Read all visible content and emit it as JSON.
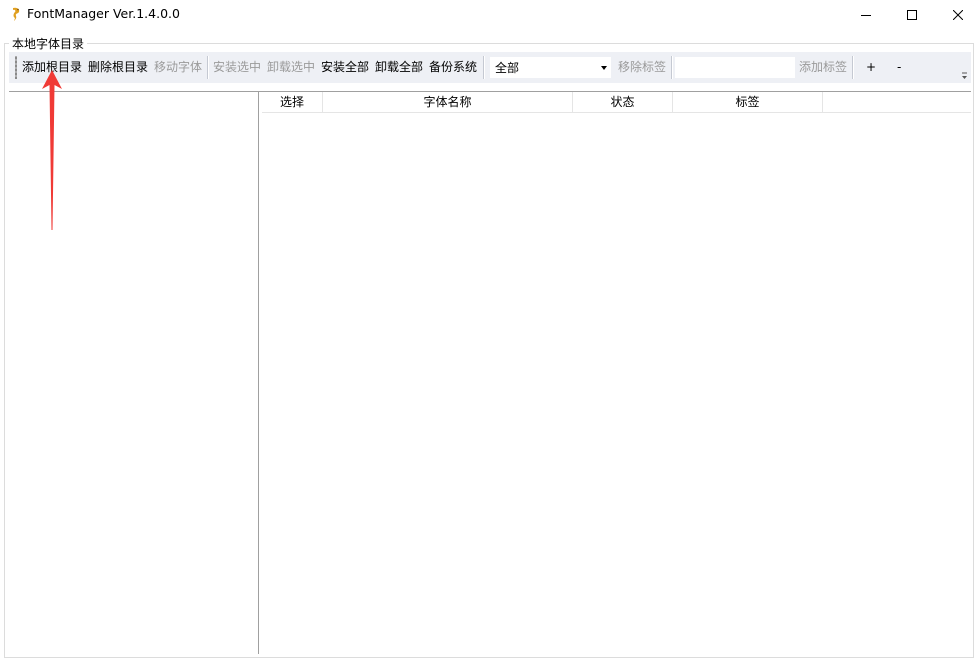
{
  "window": {
    "title": "FontManager Ver.1.4.0.0",
    "icon": "dragon-app-icon",
    "controls": [
      "minimize-icon",
      "maximize-icon",
      "close-icon"
    ]
  },
  "group": {
    "title": "本地字体目录"
  },
  "toolbar": {
    "add_root": "添加根目录",
    "delete_root": "删除根目录",
    "move_font": "移动字体",
    "install_selected": "安装选中",
    "uninstall_selected": "卸载选中",
    "install_all": "安装全部",
    "uninstall_all": "卸载全部",
    "backup_system": "备份系统",
    "filter_selected": "全部",
    "remove_tag": "移除标签",
    "tag_input_value": "",
    "add_tag": "添加标签",
    "plus": "+",
    "minus": "-"
  },
  "list": {
    "columns": [
      "选择",
      "字体名称",
      "状态",
      "标签"
    ],
    "rows": []
  },
  "colors": {
    "toolbar_bg": "#eef0f5",
    "disabled_text": "#9a9a9a",
    "annotation_arrow": "#f03a36"
  }
}
